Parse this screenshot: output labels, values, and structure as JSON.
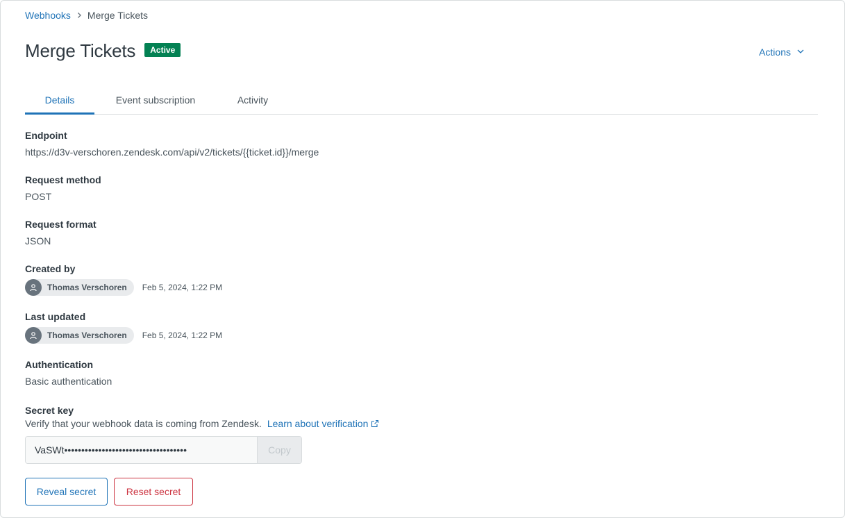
{
  "breadcrumb": {
    "parent": "Webhooks",
    "current": "Merge Tickets"
  },
  "header": {
    "title": "Merge Tickets",
    "status_badge": "Active",
    "actions_label": "Actions"
  },
  "tabs": [
    {
      "label": "Details",
      "active": true
    },
    {
      "label": "Event subscription",
      "active": false
    },
    {
      "label": "Activity",
      "active": false
    }
  ],
  "details": {
    "endpoint": {
      "label": "Endpoint",
      "value": "https://d3v-verschoren.zendesk.com/api/v2/tickets/{{ticket.id}}/merge"
    },
    "request_method": {
      "label": "Request method",
      "value": "POST"
    },
    "request_format": {
      "label": "Request format",
      "value": "JSON"
    },
    "created_by": {
      "label": "Created by",
      "user": "Thomas Verschoren",
      "date": "Feb 5, 2024, 1:22 PM"
    },
    "last_updated": {
      "label": "Last updated",
      "user": "Thomas Verschoren",
      "date": "Feb 5, 2024, 1:22 PM"
    },
    "authentication": {
      "label": "Authentication",
      "value": "Basic authentication"
    },
    "secret_key": {
      "label": "Secret key",
      "hint": "Verify that your webhook data is coming from Zendesk.",
      "learn_link": "Learn about verification",
      "value": "VaSWt••••••••••••••••••••••••••••••••••••",
      "copy_label": "Copy"
    }
  },
  "buttons": {
    "reveal": "Reveal secret",
    "reset": "Reset secret"
  },
  "colors": {
    "link": "#1f73b7",
    "active_badge": "#038153",
    "danger": "#cc3340"
  }
}
